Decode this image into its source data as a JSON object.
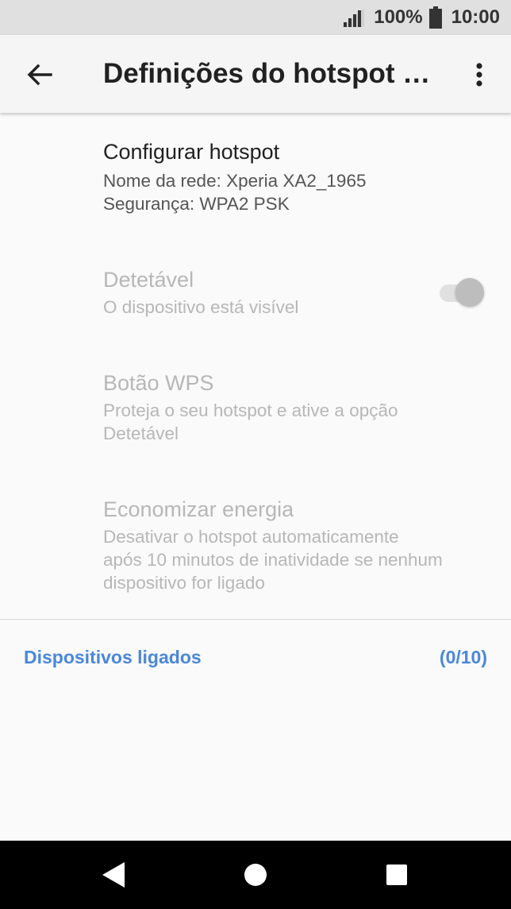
{
  "status_bar": {
    "battery_percent": "100%",
    "time": "10:00",
    "icons": [
      "signal-icon",
      "battery-icon"
    ]
  },
  "app_bar": {
    "title": "Definições do hotspot portátil",
    "back_icon": "arrow-back-icon",
    "more_icon": "more-vert-icon"
  },
  "settings": {
    "configure": {
      "title": "Configurar hotspot",
      "network_name": "Nome da rede: Xperia XA2_1965",
      "security": "Segurança: WPA2 PSK"
    },
    "discoverable": {
      "title": "Detetável",
      "subtitle": "O dispositivo está visível",
      "enabled": false,
      "toggle_on": true
    },
    "wps": {
      "title": "Botão WPS",
      "subtitle_line1": "Proteja o seu hotspot e ative a opção",
      "subtitle_line2": "Detetável"
    },
    "power_save": {
      "title": "Economizar energia",
      "subtitle_line1": "Desativar o hotspot automaticamente",
      "subtitle_line2": "após 10 minutos de inatividade se nenhum",
      "subtitle_line3": "dispositivo for ligado"
    }
  },
  "connected_devices": {
    "label": "Dispositivos ligados",
    "count": "(0/10)",
    "accent_color": "#4a87d9"
  },
  "nav_bar": {
    "icons": [
      "nav-back-icon",
      "home-icon",
      "recents-icon"
    ]
  }
}
